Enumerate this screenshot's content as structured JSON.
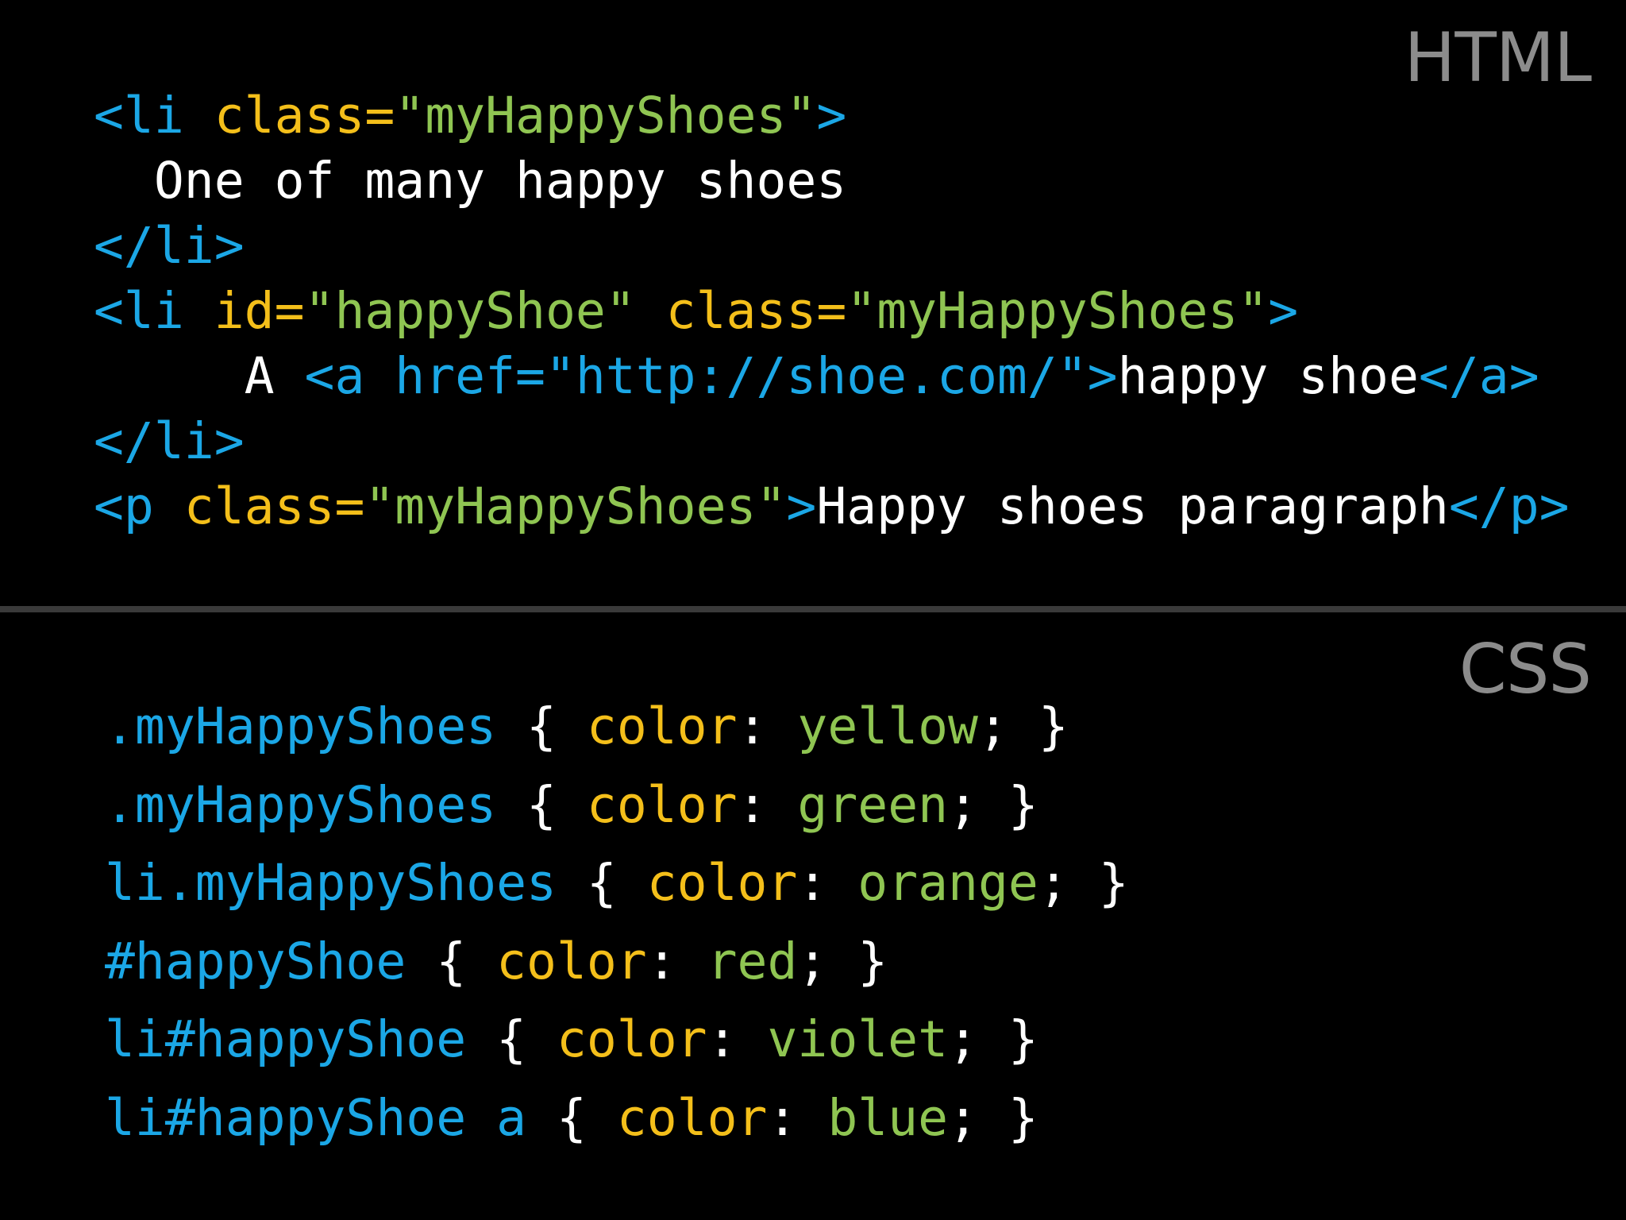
{
  "sections": {
    "html_label": "HTML",
    "css_label": "CSS"
  },
  "colors": {
    "tag": "#1ba7e6",
    "attribute": "#f4bf1a",
    "string": "#8fc552",
    "text": "#ffffff",
    "label": "#8c8c8c",
    "divider": "#3a3a3a",
    "background": "#000000"
  },
  "html_code": [
    [
      {
        "t": "<li ",
        "k": "tag"
      },
      {
        "t": "class=",
        "k": "attr"
      },
      {
        "t": "\"myHappyShoes\"",
        "k": "str"
      },
      {
        "t": ">",
        "k": "tag"
      }
    ],
    [
      {
        "t": "  One of many happy shoes",
        "k": "text"
      }
    ],
    [
      {
        "t": "</li>",
        "k": "tag"
      }
    ],
    [
      {
        "t": "<li ",
        "k": "tag"
      },
      {
        "t": "id=",
        "k": "attr"
      },
      {
        "t": "\"happyShoe\"",
        "k": "str"
      },
      {
        "t": " class=",
        "k": "attr"
      },
      {
        "t": "\"myHappyShoes\"",
        "k": "str"
      },
      {
        "t": ">",
        "k": "tag"
      }
    ],
    [
      {
        "t": "     A ",
        "k": "text"
      },
      {
        "t": "<a href=\"http://shoe.com/\">",
        "k": "tag"
      },
      {
        "t": "happy shoe",
        "k": "text"
      },
      {
        "t": "</a>",
        "k": "tag"
      }
    ],
    [
      {
        "t": "</li>",
        "k": "tag"
      }
    ],
    [
      {
        "t": "<p ",
        "k": "tag"
      },
      {
        "t": "class=",
        "k": "attr"
      },
      {
        "t": "\"myHappyShoes\"",
        "k": "str"
      },
      {
        "t": ">",
        "k": "tag"
      },
      {
        "t": "Happy shoes paragraph",
        "k": "text"
      },
      {
        "t": "</p>",
        "k": "tag"
      }
    ]
  ],
  "css_code": [
    [
      {
        "t": ".myHappyShoes",
        "k": "sel"
      },
      {
        "t": " { ",
        "k": "punc"
      },
      {
        "t": "color",
        "k": "prop"
      },
      {
        "t": ": ",
        "k": "punc"
      },
      {
        "t": "yellow",
        "k": "val"
      },
      {
        "t": "; }",
        "k": "punc"
      }
    ],
    [
      {
        "t": ".myHappyShoes",
        "k": "sel"
      },
      {
        "t": " { ",
        "k": "punc"
      },
      {
        "t": "color",
        "k": "prop"
      },
      {
        "t": ": ",
        "k": "punc"
      },
      {
        "t": "green",
        "k": "val"
      },
      {
        "t": "; }",
        "k": "punc"
      }
    ],
    [
      {
        "t": "li.myHappyShoes",
        "k": "sel"
      },
      {
        "t": " { ",
        "k": "punc"
      },
      {
        "t": "color",
        "k": "prop"
      },
      {
        "t": ": ",
        "k": "punc"
      },
      {
        "t": "orange",
        "k": "val"
      },
      {
        "t": "; }",
        "k": "punc"
      }
    ],
    [
      {
        "t": "#happyShoe",
        "k": "sel"
      },
      {
        "t": " { ",
        "k": "punc"
      },
      {
        "t": "color",
        "k": "prop"
      },
      {
        "t": ": ",
        "k": "punc"
      },
      {
        "t": "red",
        "k": "val"
      },
      {
        "t": "; }",
        "k": "punc"
      }
    ],
    [
      {
        "t": "li#happyShoe",
        "k": "sel"
      },
      {
        "t": " { ",
        "k": "punc"
      },
      {
        "t": "color",
        "k": "prop"
      },
      {
        "t": ": ",
        "k": "punc"
      },
      {
        "t": "violet",
        "k": "val"
      },
      {
        "t": "; }",
        "k": "punc"
      }
    ],
    [
      {
        "t": "li#happyShoe a",
        "k": "sel"
      },
      {
        "t": " { ",
        "k": "punc"
      },
      {
        "t": "color",
        "k": "prop"
      },
      {
        "t": ": ",
        "k": "punc"
      },
      {
        "t": "blue",
        "k": "val"
      },
      {
        "t": "; }",
        "k": "punc"
      }
    ]
  ]
}
